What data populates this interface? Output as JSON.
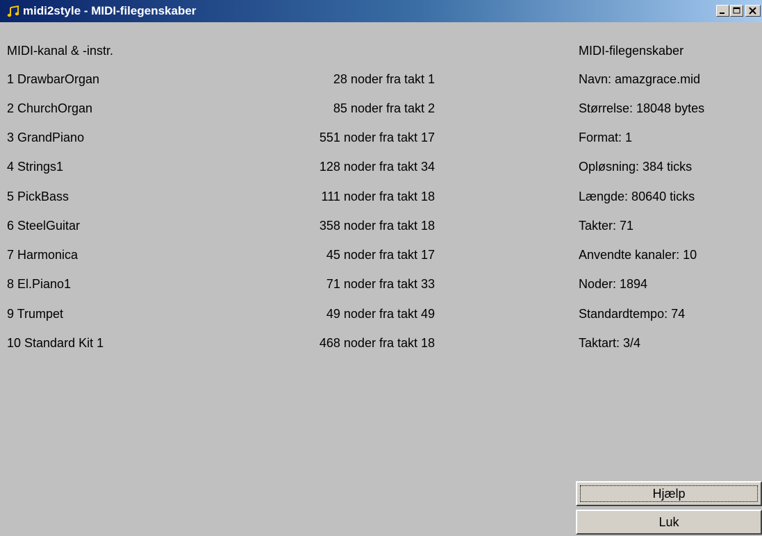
{
  "window": {
    "title": "midi2style - MIDI-filegenskaber",
    "icon": "music-note-icon"
  },
  "channels": {
    "header": "MIDI-kanal & -instr.",
    "rows": [
      {
        "instrument": "1 DrawbarOrgan",
        "notes": "28 noder fra takt 1"
      },
      {
        "instrument": "2 ChurchOrgan",
        "notes": "85 noder fra takt 2"
      },
      {
        "instrument": "3 GrandPiano",
        "notes": "551 noder fra takt 17"
      },
      {
        "instrument": "4 Strings1",
        "notes": "128 noder fra takt 34"
      },
      {
        "instrument": "5 PickBass",
        "notes": "111 noder fra takt 18"
      },
      {
        "instrument": "6 SteelGuitar",
        "notes": "358 noder fra takt 18"
      },
      {
        "instrument": "7 Harmonica",
        "notes": "45 noder fra takt 17"
      },
      {
        "instrument": "8 El.Piano1",
        "notes": "71 noder fra takt 33"
      },
      {
        "instrument": "9 Trumpet",
        "notes": "49 noder fra takt 49"
      },
      {
        "instrument": "10 Standard Kit 1",
        "notes": "468 noder fra takt 18"
      }
    ]
  },
  "properties": {
    "header": "MIDI-filegenskaber",
    "items": [
      "Navn: amazgrace.mid",
      "Størrelse: 18048 bytes",
      "Format: 1",
      "Opløsning: 384 ticks",
      "Længde: 80640 ticks",
      "Takter: 71",
      "Anvendte kanaler: 10",
      "Noder: 1894",
      "Standardtempo: 74",
      "Taktart: 3/4"
    ]
  },
  "buttons": {
    "help_label": "Hjælp",
    "close_label": "Luk"
  },
  "colors": {
    "window_bg": "#c0c0c0",
    "titlebar_start": "#0a246a",
    "titlebar_end": "#a6caf0",
    "button_face": "#d4d0c8"
  }
}
